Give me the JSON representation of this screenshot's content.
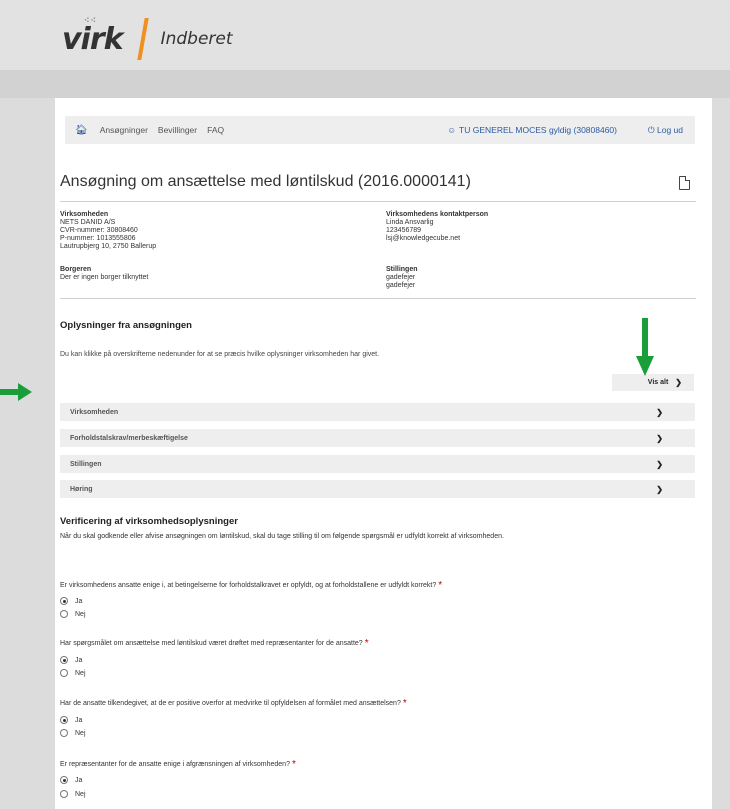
{
  "brand": {
    "logo_text": "virk",
    "subtitle": "Indberet",
    "accent_color": "#f0901e"
  },
  "nav": {
    "home_icon": "home-icon",
    "links": [
      "Ansøgninger",
      "Bevillinger",
      "FAQ"
    ],
    "user_label": "TU GENEREL MOCES gyldig (30808460)",
    "user_icon": "user-icon",
    "logout_label": "Log ud",
    "logout_icon": "power-icon",
    "link_color": "#2b5aa0"
  },
  "page": {
    "title": "Ansøgning om ansættelse med løntilskud (2016.0000141)",
    "pdf_icon": "pdf-icon"
  },
  "info": {
    "company": {
      "label": "Virksomheden",
      "lines": [
        "NETS DANID A/S",
        "CVR-nummer: 30808460",
        "P-nummer: 1013555806",
        "Lautrupbjerg 10, 2750 Ballerup"
      ]
    },
    "contact": {
      "label": "Virksomhedens kontaktperson",
      "lines": [
        "Linda Ansvarlig",
        "123456789",
        "lsj@knowledgecube.net"
      ]
    },
    "citizen": {
      "label": "Borgeren",
      "lines": [
        "Der er ingen borger tilknyttet"
      ]
    },
    "position": {
      "label": "Stillingen",
      "lines": [
        "gadefejer",
        "gadefejer"
      ]
    }
  },
  "application": {
    "title": "Oplysninger fra ansøgningen",
    "description": "Du kan klikke på overskrifterne nedenunder for at se præcis hvilke oplysninger virksomheden har givet.",
    "show_all_label": "Vis alt",
    "sections": [
      "Virksomheden",
      "Forholdstalskrav/merbeskæftigelse",
      "Stillingen",
      "Høring"
    ]
  },
  "verification": {
    "title": "Verificering af virksomhedsoplysninger",
    "description": "Når du skal godkende eller afvise ansøgningen om løntilskud, skal du tage stilling til om følgende spørgsmål er udfyldt korrekt af virksomheden.",
    "required_mark": "*",
    "questions": [
      {
        "text": "Er virksomhedens ansatte enige i, at betingelserne for forholdstalkravet er opfyldt, og at forholdstallene er udfyldt korrekt?",
        "options": [
          "Ja",
          "Nej"
        ],
        "selected": "Ja"
      },
      {
        "text": "Har spørgsmålet om ansættelse med løntilskud været drøftet med repræsentanter for de ansatte?",
        "options": [
          "Ja",
          "Nej"
        ],
        "selected": "Ja"
      },
      {
        "text": "Har de ansatte tilkendegivet, at de er positive overfor at medvirke til opfyldelsen af formålet med ansættelsen?",
        "options": [
          "Ja",
          "Nej"
        ],
        "selected": "Ja"
      },
      {
        "text": "Er repræsentanter for de ansatte enige i afgrænsningen af virksomheden?",
        "options": [
          "Ja",
          "Nej"
        ],
        "selected": "Ja"
      }
    ]
  },
  "annotations": {
    "arrow_color": "#1a9e3a"
  }
}
